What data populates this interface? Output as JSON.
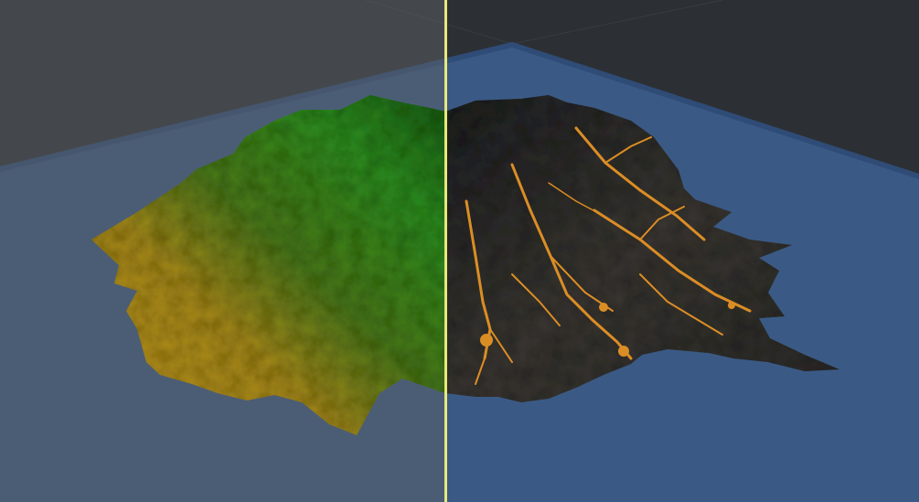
{
  "viewport": {
    "background_color": "#2b2b2b",
    "water_color": "#3b5a86",
    "left_view": {
      "mode": "elevation",
      "colors": {
        "low": "#b88a1a",
        "mid": "#3a7a1a",
        "high": "#2f9a26",
        "shadow": "#1f2a10"
      }
    },
    "right_view": {
      "mode": "flow",
      "colors": {
        "terrain": "#3a3328",
        "terrain_dark": "#1f1a14",
        "flow": "#f29418"
      }
    },
    "split_handle": {
      "color": "#e8e87a"
    }
  }
}
